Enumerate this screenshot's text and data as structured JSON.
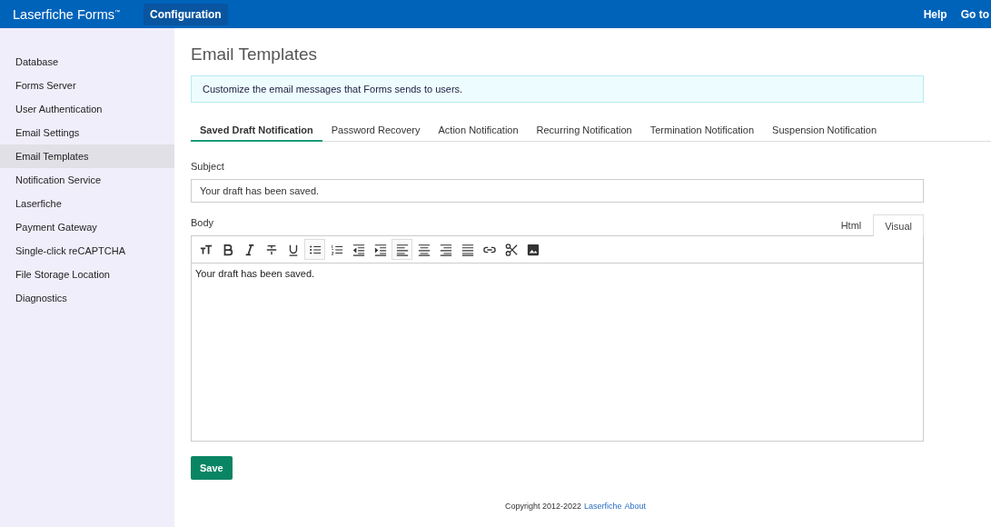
{
  "header": {
    "logo": "Laserfiche Forms$^{™}$",
    "nav": [
      {
        "label": "Configuration",
        "selected": true
      }
    ],
    "links": [
      "Help",
      "Go to"
    ]
  },
  "sidebar": {
    "items": [
      {
        "label": "Database",
        "selected": false
      },
      {
        "label": "Forms Server",
        "selected": false
      },
      {
        "label": "User Authentication",
        "selected": false
      },
      {
        "label": "Email Settings",
        "selected": false
      },
      {
        "label": "Email Templates",
        "selected": true
      },
      {
        "label": "Notification Service",
        "selected": false
      },
      {
        "label": "Laserfiche",
        "selected": false
      },
      {
        "label": "Payment Gateway",
        "selected": false
      },
      {
        "label": "Single-click reCAPTCHA",
        "selected": false
      },
      {
        "label": "File Storage Location",
        "selected": false
      },
      {
        "label": "Diagnostics",
        "selected": false
      }
    ]
  },
  "page": {
    "title": "Email Templates",
    "info": "Customize the email messages that Forms sends to users."
  },
  "tabs": [
    {
      "label": "Saved Draft Notification",
      "selected": true
    },
    {
      "label": "Password Recovery",
      "selected": false
    },
    {
      "label": "Action Notification",
      "selected": false
    },
    {
      "label": "Recurring Notification",
      "selected": false
    },
    {
      "label": "Termination Notification",
      "selected": false
    },
    {
      "label": "Suspension Notification",
      "selected": false
    }
  ],
  "subject": {
    "label": "Subject",
    "value": "Your draft has been saved."
  },
  "body": {
    "label": "Body",
    "modes": [
      {
        "label": "Html",
        "selected": false
      },
      {
        "label": "Visual",
        "selected": true
      }
    ],
    "toolbar": [
      {
        "kind": "font-size",
        "selected": false
      },
      {
        "kind": "bold",
        "selected": false
      },
      {
        "kind": "italic",
        "selected": false
      },
      {
        "kind": "strikethrough",
        "selected": false
      },
      {
        "kind": "underline",
        "selected": false
      },
      {
        "kind": "bullet-list",
        "selected": true
      },
      {
        "kind": "numbered-list",
        "selected": false
      },
      {
        "kind": "outdent",
        "selected": false
      },
      {
        "kind": "indent",
        "selected": false
      },
      {
        "kind": "align-left",
        "selected": true
      },
      {
        "kind": "align-center",
        "selected": false
      },
      {
        "kind": "align-right",
        "selected": false
      },
      {
        "kind": "justify",
        "selected": false
      },
      {
        "kind": "link",
        "selected": false
      },
      {
        "kind": "cut",
        "selected": false
      },
      {
        "kind": "image",
        "selected": false
      }
    ],
    "content": "Your draft has been saved."
  },
  "save_button": "Save",
  "footer": {
    "text": "Copyright 2012-2022",
    "links": [
      "Laserfiche",
      "About"
    ]
  }
}
